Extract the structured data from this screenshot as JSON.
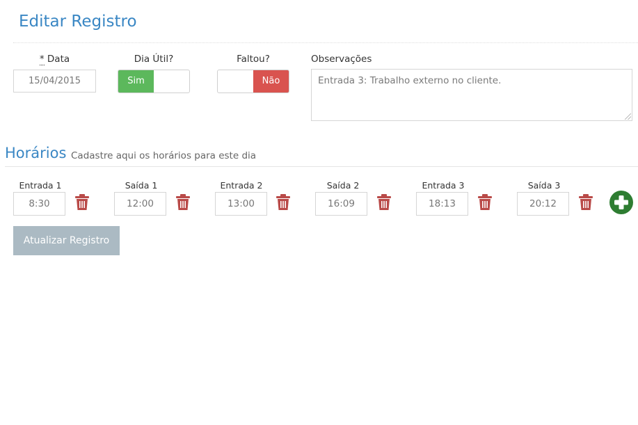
{
  "page": {
    "title": "Editar Registro"
  },
  "form": {
    "date": {
      "required_mark": "*",
      "label": "Data",
      "value": "15/04/2015"
    },
    "dia_util": {
      "label": "Dia Útil?",
      "on_label": "Sim",
      "state": "on"
    },
    "faltou": {
      "label": "Faltou?",
      "off_label": "Não",
      "state": "off"
    },
    "observacoes": {
      "label": "Observações",
      "value": "Entrada 3: Trabalho externo no cliente."
    }
  },
  "horarios": {
    "title": "Horários",
    "subtitle": "Cadastre aqui os horários para este dia",
    "entries": [
      {
        "label": "Entrada 1",
        "value": "8:30"
      },
      {
        "label": "Saída 1",
        "value": "12:00"
      },
      {
        "label": "Entrada 2",
        "value": "13:00"
      },
      {
        "label": "Saída 2",
        "value": "16:09"
      },
      {
        "label": "Entrada 3",
        "value": "18:13"
      },
      {
        "label": "Saída 3",
        "value": "20:12"
      }
    ]
  },
  "actions": {
    "update_label": "Atualizar Registro"
  },
  "colors": {
    "accent": "#3a87c4",
    "toggle_on": "#5cb85c",
    "toggle_off": "#d9534f",
    "trash": "#b94a48",
    "add": "#2e7d32",
    "button_disabled": "#abbac3"
  },
  "icons": {
    "delete": "trash-icon",
    "add": "plus-circle-icon"
  }
}
